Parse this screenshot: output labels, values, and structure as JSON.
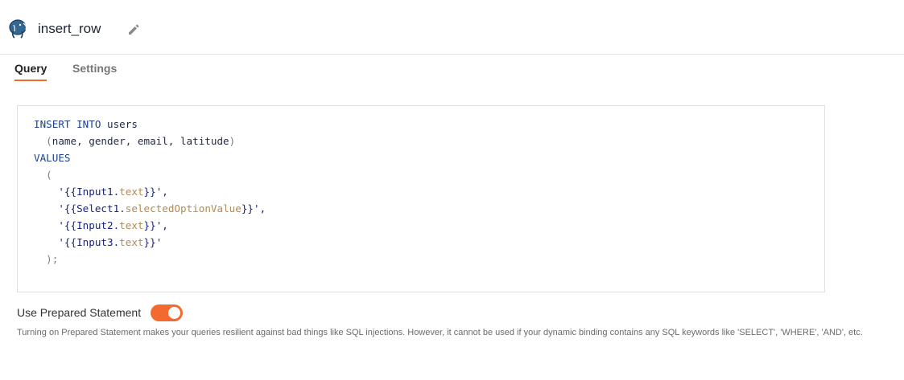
{
  "header": {
    "query_name": "insert_row",
    "db_icon": "postgresql-elephant-icon",
    "edit_icon": "pencil-icon"
  },
  "tabs": [
    {
      "label": "Query",
      "active": true
    },
    {
      "label": "Settings",
      "active": false
    }
  ],
  "editor": {
    "lines": [
      [
        {
          "t": "INSERT INTO",
          "c": "kw"
        },
        {
          "t": " users",
          "c": "ident"
        }
      ],
      [
        {
          "t": "  (",
          "c": "punct"
        },
        {
          "t": "name, gender, email, latitude",
          "c": "ident"
        },
        {
          "t": ")",
          "c": "punct"
        }
      ],
      [
        {
          "t": "VALUES",
          "c": "kw"
        }
      ],
      [
        {
          "t": "  (",
          "c": "punct"
        }
      ],
      [
        {
          "t": "    '",
          "c": "str"
        },
        {
          "t": "{{Input1.",
          "c": "binding"
        },
        {
          "t": "text",
          "c": "prop"
        },
        {
          "t": "}}",
          "c": "binding"
        },
        {
          "t": "',",
          "c": "str"
        }
      ],
      [
        {
          "t": "    '",
          "c": "str"
        },
        {
          "t": "{{Select1.",
          "c": "binding"
        },
        {
          "t": "selectedOptionValue",
          "c": "prop"
        },
        {
          "t": "}}",
          "c": "binding"
        },
        {
          "t": "',",
          "c": "str"
        }
      ],
      [
        {
          "t": "    '",
          "c": "str"
        },
        {
          "t": "{{Input2.",
          "c": "binding"
        },
        {
          "t": "text",
          "c": "prop"
        },
        {
          "t": "}}",
          "c": "binding"
        },
        {
          "t": "',",
          "c": "str"
        }
      ],
      [
        {
          "t": "    '",
          "c": "str"
        },
        {
          "t": "{{Input3.",
          "c": "binding"
        },
        {
          "t": "text",
          "c": "prop"
        },
        {
          "t": "}}",
          "c": "binding"
        },
        {
          "t": "'",
          "c": "str"
        }
      ],
      [
        {
          "t": "  );",
          "c": "punct"
        }
      ]
    ]
  },
  "prepared_statement": {
    "label": "Use Prepared Statement",
    "enabled": true,
    "help": "Turning on Prepared Statement makes your queries resilient against bad things like SQL injections. However, it cannot be used if your dynamic binding contains any SQL keywords like 'SELECT', 'WHERE', 'AND', etc."
  },
  "colors": {
    "accent": "#f4692f",
    "keyword": "#1c3f8f",
    "binding_prop": "#b08b55"
  }
}
